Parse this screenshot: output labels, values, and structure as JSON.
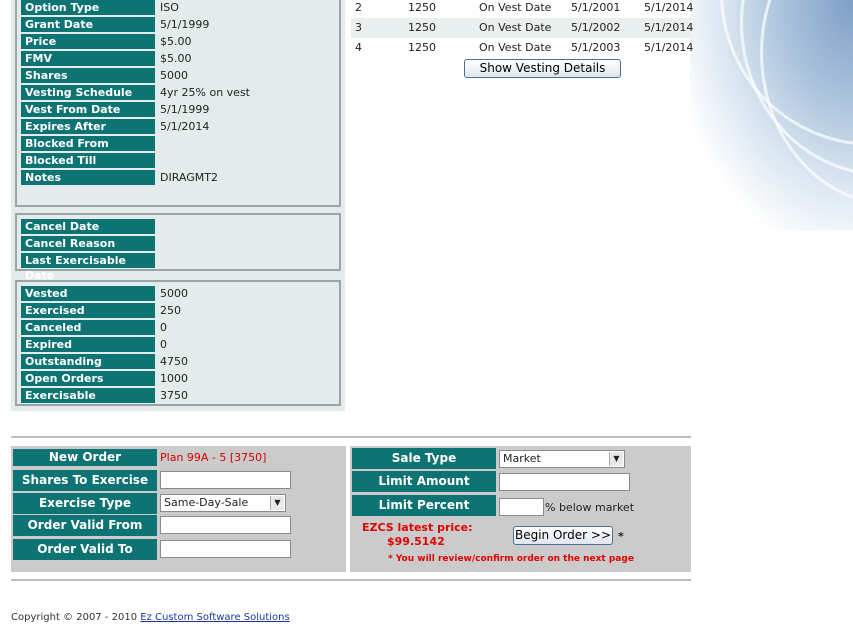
{
  "details": {
    "rows": [
      {
        "label": "Option Type",
        "value": "ISO"
      },
      {
        "label": "Grant Date",
        "value": "5/1/1999"
      },
      {
        "label": "Price",
        "value": "$5.00"
      },
      {
        "label": "FMV",
        "value": "$5.00"
      },
      {
        "label": "Shares",
        "value": "5000"
      },
      {
        "label": "Vesting Schedule",
        "value": "4yr 25% on vest"
      },
      {
        "label": "Vest From Date",
        "value": "5/1/1999"
      },
      {
        "label": "Expires After",
        "value": "5/1/2014"
      },
      {
        "label": "Blocked From",
        "value": ""
      },
      {
        "label": "Blocked Till",
        "value": ""
      },
      {
        "label": "Notes",
        "value": "DIRAGMT2"
      }
    ]
  },
  "cancel": {
    "rows": [
      {
        "label": "Cancel Date",
        "value": ""
      },
      {
        "label": "Cancel Reason",
        "value": ""
      },
      {
        "label": "Last Exercisable Date",
        "value": ""
      }
    ]
  },
  "summary": {
    "rows": [
      {
        "label": "Vested",
        "value": "5000"
      },
      {
        "label": "Exercised",
        "value": "250"
      },
      {
        "label": "Canceled",
        "value": "0"
      },
      {
        "label": "Expired",
        "value": "0"
      },
      {
        "label": "Outstanding",
        "value": "4750"
      },
      {
        "label": "Open Orders",
        "value": "1000"
      },
      {
        "label": "Exercisable",
        "value": "3750"
      }
    ]
  },
  "vesting": {
    "rows": [
      {
        "num": "2",
        "shares": "1250",
        "type": "On Vest Date",
        "vest": "5/1/2001",
        "expire": "5/1/2014"
      },
      {
        "num": "3",
        "shares": "1250",
        "type": "On Vest Date",
        "vest": "5/1/2002",
        "expire": "5/1/2014"
      },
      {
        "num": "4",
        "shares": "1250",
        "type": "On Vest Date",
        "vest": "5/1/2003",
        "expire": "5/1/2014"
      }
    ],
    "show_details_label": "Show Vesting Details"
  },
  "order": {
    "new_order_label": "New Order",
    "plan_value": "Plan 99A - 5 [3750]",
    "shares_label": "Shares To Exercise",
    "shares_value": "",
    "exercise_type_label": "Exercise Type",
    "exercise_type_value": "Same-Day-Sale",
    "valid_from_label": "Order Valid From",
    "valid_from_value": "",
    "valid_to_label": "Order Valid To",
    "valid_to_value": "",
    "sale_type_label": "Sale Type",
    "sale_type_value": "Market",
    "limit_amount_label": "Limit Amount",
    "limit_amount_value": "",
    "limit_percent_label": "Limit Percent",
    "limit_percent_value": "",
    "below_market_text": "% below market",
    "price_label": "EZCS latest price:",
    "price_value": "$99.5142",
    "begin_order_label": "Begin Order >>",
    "asterisk": "*",
    "review_note": "* You will review/confirm order on the next page"
  },
  "footer": {
    "copyright": "Copyright © 2007 - 2010",
    "company_link": "Ez Custom Software Solutions"
  },
  "colors": {
    "label_bg": "#0e7373",
    "panel_bg": "#e3ebeb",
    "order_bg": "#cbcbcb",
    "accent_red": "#e00000"
  }
}
